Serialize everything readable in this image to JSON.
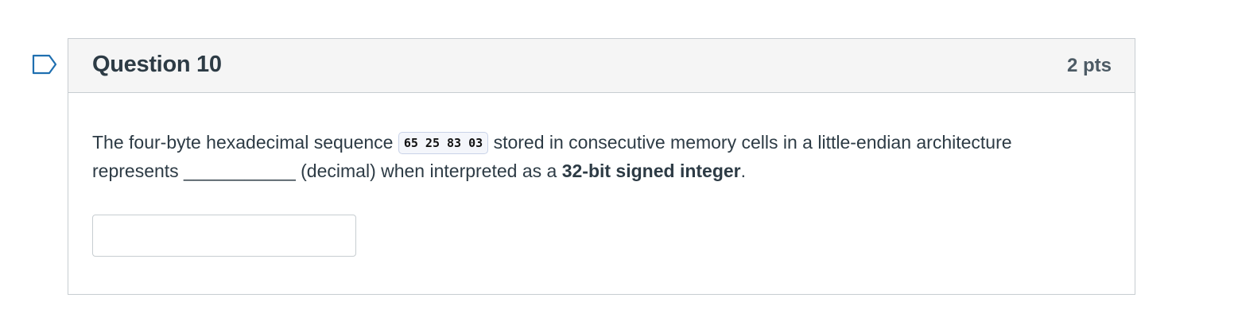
{
  "question": {
    "title": "Question 10",
    "points": "2 pts",
    "flag_icon": "flag-bookmark-icon",
    "text_intro": "The four-byte hexadecimal sequence ",
    "code": "65 25 83 03",
    "text_middle": " stored in consecutive memory cells in a little-endian architecture represents ___________ (decimal) when interpreted as a ",
    "text_bold": "32-bit signed integer",
    "text_end": ".",
    "answer_value": "",
    "answer_placeholder": ""
  },
  "colors": {
    "header_bg": "#f5f5f5",
    "border": "#c7cdd1",
    "text": "#2d3b45",
    "flag_stroke": "#1f6fb0"
  }
}
